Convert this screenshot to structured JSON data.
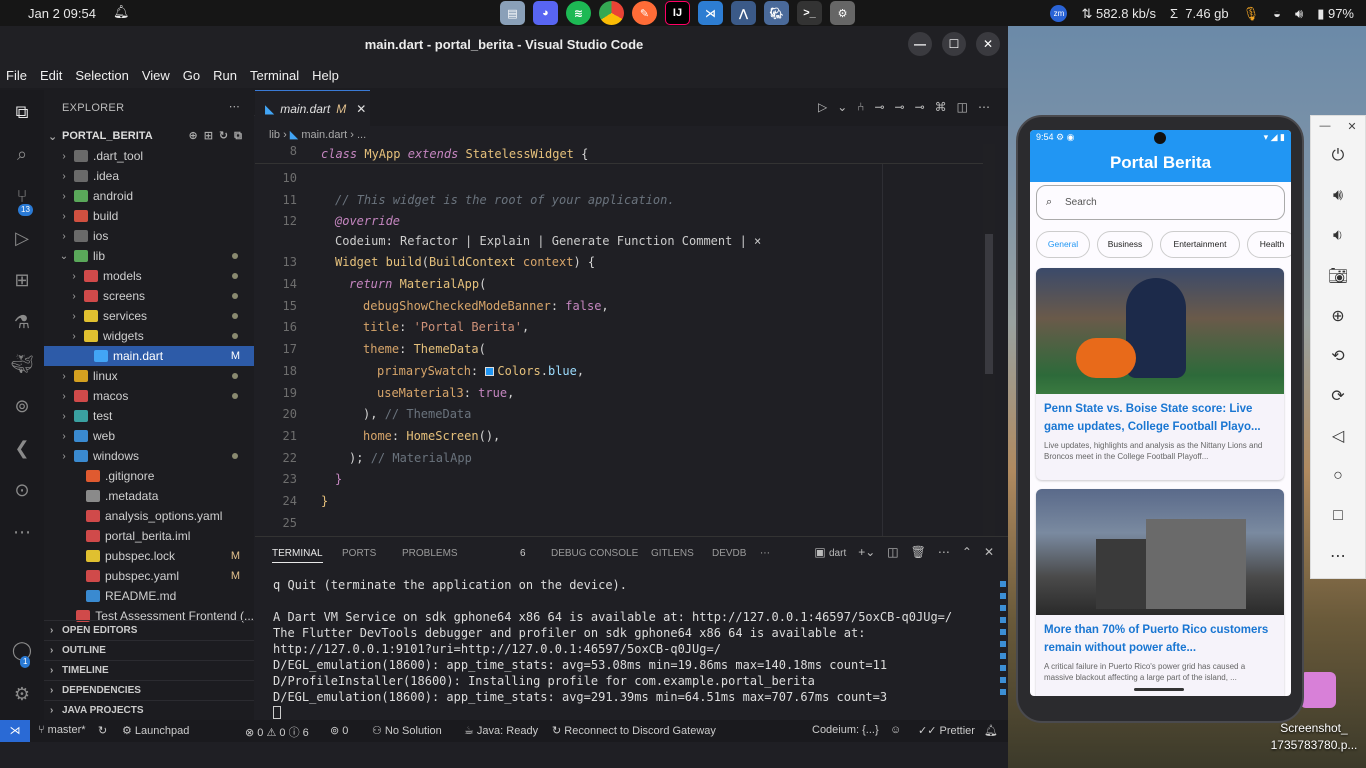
{
  "topbar": {
    "date": "Jan 2  09:54",
    "net_speed": "582.8 kb/s",
    "sigma": "Σ",
    "mem": "7.46 gb",
    "battery": "97%",
    "zoom_badge": "zm"
  },
  "window": {
    "title": "main.dart - portal_berita - Visual Studio Code"
  },
  "menu": [
    "File",
    "Edit",
    "Selection",
    "View",
    "Go",
    "Run",
    "Terminal",
    "Help"
  ],
  "command_center": {
    "placeholder": "portal_berita"
  },
  "activity": {
    "source_control_badge": "13",
    "accounts_badge": "1"
  },
  "explorer": {
    "header": "EXPLORER",
    "project": "PORTAL_BERITA",
    "items": [
      {
        "label": ".dart_tool",
        "mark": ""
      },
      {
        "label": ".idea",
        "mark": ""
      },
      {
        "label": "android",
        "mark": ""
      },
      {
        "label": "build",
        "mark": ""
      },
      {
        "label": "ios",
        "mark": ""
      },
      {
        "label": "lib",
        "mark": "dot"
      },
      {
        "label": "models",
        "mark": "dot"
      },
      {
        "label": "screens",
        "mark": "dot"
      },
      {
        "label": "services",
        "mark": "dot"
      },
      {
        "label": "widgets",
        "mark": "dot"
      },
      {
        "label": "main.dart",
        "mark": "M"
      },
      {
        "label": "linux",
        "mark": "dot"
      },
      {
        "label": "macos",
        "mark": "dot"
      },
      {
        "label": "test",
        "mark": ""
      },
      {
        "label": "web",
        "mark": ""
      },
      {
        "label": "windows",
        "mark": "dot"
      },
      {
        "label": ".gitignore",
        "mark": ""
      },
      {
        "label": ".metadata",
        "mark": ""
      },
      {
        "label": "analysis_options.yaml",
        "mark": ""
      },
      {
        "label": "portal_berita.iml",
        "mark": ""
      },
      {
        "label": "pubspec.lock",
        "mark": "M"
      },
      {
        "label": "pubspec.yaml",
        "mark": "M"
      },
      {
        "label": "README.md",
        "mark": ""
      },
      {
        "label": "Test Assessment Frontend (...",
        "mark": ""
      }
    ],
    "panels": [
      "OPEN EDITORS",
      "OUTLINE",
      "TIMELINE",
      "DEPENDENCIES",
      "JAVA PROJECTS"
    ]
  },
  "editor": {
    "tab_label": "main.dart",
    "tab_mark": "M",
    "breadcrumb": [
      "lib",
      "main.dart",
      "..."
    ],
    "sticky_line_no": "8",
    "line_numbers": [
      "10",
      "11",
      "12",
      "13",
      "14",
      "15",
      "16",
      "17",
      "18",
      "19",
      "20",
      "21",
      "22",
      "23",
      "24",
      "25"
    ],
    "codelens": "Codeium: Refactor | Explain | Generate Function Comment | ×"
  },
  "terminal": {
    "tabs": [
      "TERMINAL",
      "PORTS",
      "PROBLEMS",
      "DEBUG CONSOLE",
      "GITLENS",
      "DEVDB"
    ],
    "problems_count": "6",
    "shell": "dart",
    "lines": [
      "q Quit (terminate the application on the device).",
      "",
      "A Dart VM Service on sdk gphone64 x86 64 is available at: http://127.0.0.1:46597/5oxCB-q0JUg=/",
      "The Flutter DevTools debugger and profiler on sdk gphone64 x86 64 is available at:",
      "http://127.0.0.1:9101?uri=http://127.0.0.1:46597/5oxCB-q0JUg=/",
      "D/EGL_emulation(18600): app_time_stats: avg=53.08ms min=19.86ms max=140.18ms count=11",
      "D/ProfileInstaller(18600): Installing profile for com.example.portal_berita",
      "D/EGL_emulation(18600): app_time_stats: avg=291.39ms min=64.51ms max=707.67ms count=3"
    ]
  },
  "statusbar": {
    "branch": "master*",
    "launchpad": "Launchpad",
    "errors": "0",
    "warnings": "0",
    "infos": "6",
    "ports": "0",
    "solution": "No Solution",
    "java": "Java: Ready",
    "discord": "Reconnect to Discord Gateway",
    "codeium": "Codeium: {...}",
    "prettier": "Prettier"
  },
  "phone": {
    "time": "9:54",
    "app_title": "Portal Berita",
    "search_placeholder": "Search",
    "chips": [
      "General",
      "Business",
      "Entertainment",
      "Health"
    ],
    "articles": [
      {
        "title": "Penn State vs. Boise State score: Live game updates, College Football Playo...",
        "desc": "Live updates, highlights and analysis as the Nittany Lions and Broncos meet in the College Football Playoff..."
      },
      {
        "title": "More than 70% of Puerto Rico customers remain without power afte...",
        "desc": "A critical failure in Puerto Rico's power grid has caused a massive blackout affecting a large part of the island, ..."
      }
    ]
  },
  "desktop": {
    "file_label": "Screenshot_\n1735783780.p..."
  }
}
